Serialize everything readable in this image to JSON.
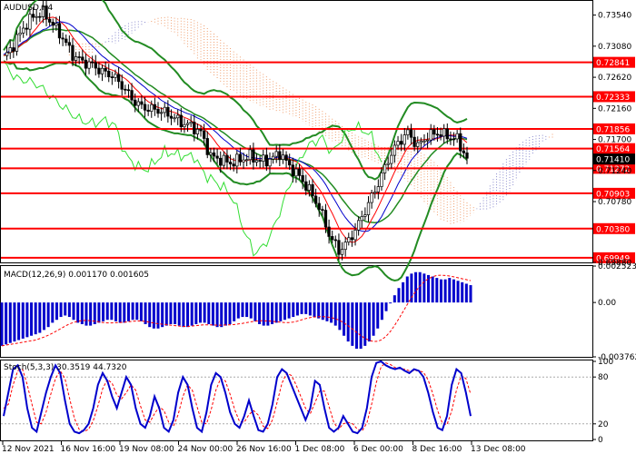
{
  "chart_title": "AUDUSD,H4",
  "macd_label": "MACD(12,26,9) 0.001170 0.001605",
  "stoch_label": "Stoch(5,3,3) 30.3519 44.7320",
  "colors": {
    "level_line": "#ff0000",
    "bollinger": "#228b22",
    "fast_ma": "#ff0000",
    "slow_ma": "#0000cc",
    "chikou": "#33dd33",
    "cloud_a": "#8888cc",
    "cloud_b": "#f0a070",
    "macd_hist": "#0000cc",
    "macd_signal": "#ff0000",
    "stoch_main": "#0000cc",
    "stoch_signal": "#ff0000",
    "current_price_box": "#000000"
  },
  "chart_data": {
    "type": "candlestick",
    "price_axis": {
      "ticks": [
        "0.73540",
        "0.73080",
        "0.72620",
        "0.72160",
        "0.71700",
        "0.71240",
        "0.70780",
        "0.69880"
      ],
      "ylim": [
        0.6988,
        0.7375
      ]
    },
    "levels": [
      {
        "label": "0.72841",
        "value": 0.72841
      },
      {
        "label": "0.72333",
        "value": 0.72333
      },
      {
        "label": "0.71856",
        "value": 0.71856
      },
      {
        "label": "0.71564",
        "value": 0.71564
      },
      {
        "label": "0.71272",
        "value": 0.71272
      },
      {
        "label": "0.70903",
        "value": 0.70903
      },
      {
        "label": "0.70380",
        "value": 0.7038
      },
      {
        "label": "0.69949",
        "value": 0.69949
      }
    ],
    "current_price": {
      "label": "0.71410",
      "value": 0.7141
    },
    "time_labels": [
      "12 Nov 2021",
      "16 Nov 16:00",
      "19 Nov 08:00",
      "24 Nov 00:00",
      "26 Nov 16:00",
      "1 Dec 08:00",
      "6 Dec 00:00",
      "8 Dec 16:00",
      "13 Dec 08:00"
    ],
    "close_path": [
      [
        0,
        0.729
      ],
      [
        3,
        0.731
      ],
      [
        6,
        0.7335
      ],
      [
        9,
        0.7352
      ],
      [
        12,
        0.7358
      ],
      [
        15,
        0.734
      ],
      [
        18,
        0.732
      ],
      [
        21,
        0.7295
      ],
      [
        24,
        0.7285
      ],
      [
        27,
        0.728
      ],
      [
        30,
        0.727
      ],
      [
        33,
        0.7265
      ],
      [
        36,
        0.725
      ],
      [
        39,
        0.723
      ],
      [
        42,
        0.7218
      ],
      [
        45,
        0.7215
      ],
      [
        48,
        0.7212
      ],
      [
        51,
        0.7205
      ],
      [
        54,
        0.7195
      ],
      [
        57,
        0.719
      ],
      [
        60,
        0.718
      ],
      [
        63,
        0.7145
      ],
      [
        66,
        0.714
      ],
      [
        69,
        0.7135
      ],
      [
        72,
        0.714
      ],
      [
        75,
        0.7145
      ],
      [
        78,
        0.7138
      ],
      [
        81,
        0.714
      ],
      [
        84,
        0.715
      ],
      [
        87,
        0.713
      ],
      [
        90,
        0.7115
      ],
      [
        93,
        0.7095
      ],
      [
        96,
        0.707
      ],
      [
        99,
        0.703
      ],
      [
        102,
        0.7005
      ],
      [
        105,
        0.702
      ],
      [
        108,
        0.7045
      ],
      [
        111,
        0.7075
      ],
      [
        114,
        0.7105
      ],
      [
        117,
        0.714
      ],
      [
        120,
        0.7165
      ],
      [
        123,
        0.718
      ],
      [
        126,
        0.716
      ],
      [
        129,
        0.7175
      ],
      [
        132,
        0.718
      ],
      [
        135,
        0.7175
      ],
      [
        138,
        0.717
      ],
      [
        141,
        0.7141
      ]
    ],
    "macd": {
      "ylim": [
        -0.003762,
        0.002523
      ],
      "ticks": [
        "0.002523",
        "0.00",
        "-0.003762"
      ],
      "histogram": [
        -0.003,
        -0.0029,
        -0.0028,
        -0.0027,
        -0.0026,
        -0.0025,
        -0.0024,
        -0.0023,
        -0.0022,
        -0.0021,
        -0.0019,
        -0.0017,
        -0.0014,
        -0.0012,
        -0.001,
        -0.0009,
        -0.001,
        -0.0012,
        -0.0014,
        -0.0015,
        -0.0016,
        -0.0016,
        -0.0015,
        -0.0014,
        -0.0013,
        -0.0012,
        -0.0012,
        -0.0013,
        -0.0014,
        -0.0014,
        -0.0013,
        -0.0012,
        -0.0012,
        -0.0013,
        -0.0015,
        -0.0017,
        -0.0018,
        -0.0018,
        -0.0017,
        -0.0016,
        -0.0015,
        -0.0015,
        -0.0016,
        -0.0017,
        -0.0017,
        -0.0016,
        -0.0015,
        -0.0014,
        -0.0014,
        -0.0015,
        -0.0016,
        -0.0017,
        -0.0017,
        -0.0016,
        -0.0015,
        -0.0013,
        -0.0011,
        -0.001,
        -0.001,
        -0.0011,
        -0.0013,
        -0.0015,
        -0.0016,
        -0.0016,
        -0.0015,
        -0.0014,
        -0.0013,
        -0.0012,
        -0.0011,
        -0.001,
        -0.0009,
        -0.0008,
        -0.0008,
        -0.0009,
        -0.001,
        -0.0011,
        -0.0012,
        -0.0013,
        -0.0014,
        -0.0016,
        -0.0019,
        -0.0023,
        -0.0027,
        -0.003,
        -0.0032,
        -0.0032,
        -0.003,
        -0.0027,
        -0.0023,
        -0.0018,
        -0.0012,
        -0.0006,
        0.0,
        0.0005,
        0.001,
        0.0014,
        0.0018,
        0.002,
        0.0021,
        0.0021,
        0.002,
        0.0019,
        0.0018,
        0.0017,
        0.0016,
        0.0016,
        0.0017,
        0.0016,
        0.0015,
        0.0014,
        0.0013,
        0.0012
      ]
    },
    "stochastic": {
      "ylim": [
        0,
        100
      ],
      "ticks": [
        "100",
        "80",
        "20",
        "0"
      ],
      "main": [
        30,
        60,
        90,
        95,
        80,
        40,
        15,
        10,
        35,
        60,
        80,
        95,
        85,
        50,
        20,
        10,
        8,
        12,
        20,
        40,
        70,
        85,
        75,
        55,
        40,
        60,
        80,
        70,
        40,
        20,
        15,
        30,
        55,
        40,
        15,
        10,
        25,
        60,
        80,
        70,
        40,
        15,
        10,
        35,
        70,
        85,
        80,
        60,
        35,
        20,
        15,
        30,
        50,
        30,
        12,
        10,
        20,
        45,
        80,
        90,
        85,
        70,
        55,
        40,
        25,
        40,
        75,
        70,
        40,
        15,
        10,
        15,
        30,
        20,
        10,
        8,
        15,
        40,
        80,
        98,
        100,
        95,
        92,
        90,
        92,
        88,
        85,
        90,
        88,
        80,
        60,
        35,
        15,
        12,
        30,
        70,
        90,
        85,
        60,
        30
      ],
      "signal": [
        40,
        45,
        70,
        88,
        90,
        70,
        45,
        22,
        20,
        35,
        58,
        78,
        88,
        78,
        52,
        27,
        13,
        10,
        13,
        24,
        43,
        65,
        77,
        72,
        57,
        52,
        60,
        70,
        63,
        43,
        25,
        22,
        33,
        42,
        37,
        22,
        17,
        32,
        55,
        70,
        63,
        42,
        22,
        20,
        38,
        63,
        78,
        75,
        58,
        38,
        23,
        22,
        32,
        37,
        31,
        17,
        14,
        25,
        48,
        72,
        85,
        82,
        70,
        55,
        40,
        33,
        47,
        62,
        62,
        42,
        22,
        13,
        20,
        22,
        20,
        13,
        11,
        21,
        45,
        73,
        93,
        98,
        96,
        92,
        91,
        90,
        88,
        88,
        88,
        86,
        76,
        58,
        37,
        21,
        19,
        37,
        63,
        82,
        78,
        58
      ]
    }
  }
}
